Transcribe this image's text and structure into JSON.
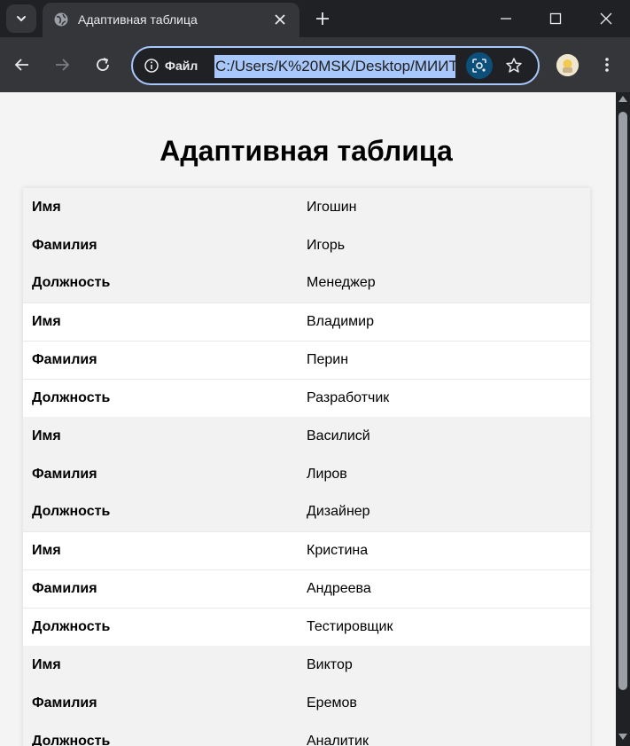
{
  "browser": {
    "tab": {
      "title": "Адаптивная таблица",
      "favicon": "globe-icon"
    },
    "address_bar": {
      "scheme_label": "Файл",
      "url": "C:/Users/K%20MSK/Desktop/МИИТ"
    },
    "colors": {
      "frame": "#202124",
      "toolbar": "#35363a",
      "accent": "#a8c7fa"
    }
  },
  "page": {
    "title": "Адаптивная таблица",
    "rows": [
      {
        "label": "Имя",
        "value": "Игошин"
      },
      {
        "label": "Фамилия",
        "value": "Игорь"
      },
      {
        "label": "Должность",
        "value": "Менеджер"
      },
      {
        "label": "Имя",
        "value": "Владимир"
      },
      {
        "label": "Фамилия",
        "value": "Перин"
      },
      {
        "label": "Должность",
        "value": "Разработчик"
      },
      {
        "label": "Имя",
        "value": "Василисй"
      },
      {
        "label": "Фамилия",
        "value": "Лиров"
      },
      {
        "label": "Должность",
        "value": "Дизайнер"
      },
      {
        "label": "Имя",
        "value": "Кристина"
      },
      {
        "label": "Фамилия",
        "value": "Андреева"
      },
      {
        "label": "Должность",
        "value": "Тестировщик"
      },
      {
        "label": "Имя",
        "value": "Виктор"
      },
      {
        "label": "Фамилия",
        "value": "Еремов"
      },
      {
        "label": "Должность",
        "value": "Аналитик"
      }
    ]
  }
}
